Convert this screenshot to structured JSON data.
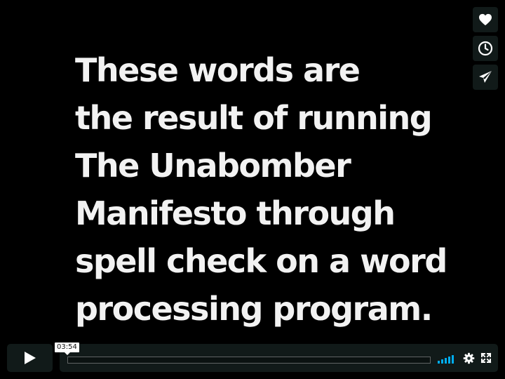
{
  "caption": {
    "lines": [
      "These words are",
      "the result of running",
      "The Unabomber",
      "Manifesto through",
      "spell check on a word",
      "processing program."
    ]
  },
  "sidebar": {
    "buttons": [
      {
        "name": "like-button",
        "icon": "heart-icon"
      },
      {
        "name": "watch-later-button",
        "icon": "clock-icon"
      },
      {
        "name": "share-button",
        "icon": "paper-plane-icon"
      }
    ]
  },
  "player": {
    "time_tooltip": "03:54",
    "progress_fraction": 0.0,
    "volume_level": 1.0,
    "accent_color": "#00adef"
  }
}
